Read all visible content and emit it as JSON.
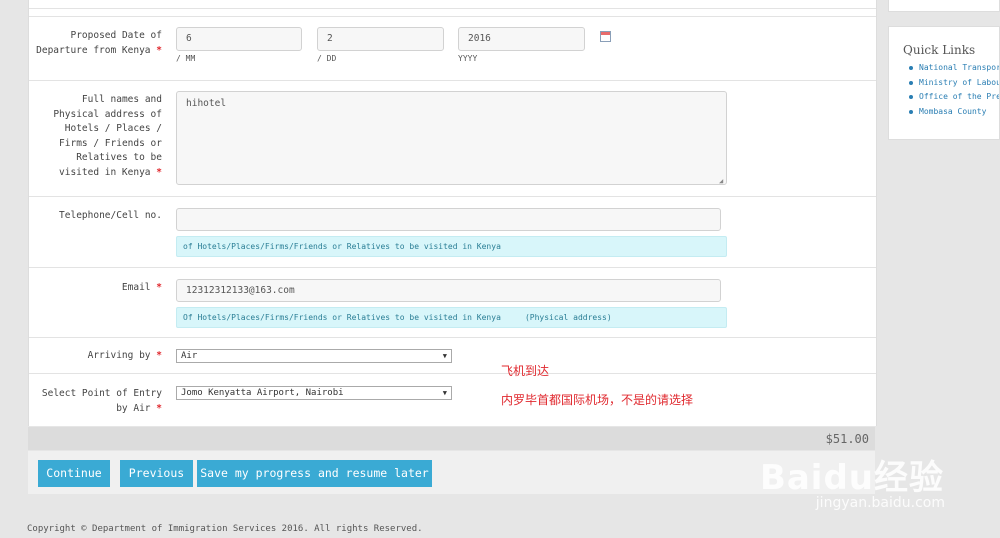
{
  "form": {
    "departure": {
      "label": "Proposed Date of Departure from Kenya",
      "day": "6",
      "day_hint": "/ MM",
      "month": "2",
      "month_hint": "/ DD",
      "year": "2016",
      "year_hint": "YYYY"
    },
    "address": {
      "label": "Full names and Physical address of Hotels / Places / Firms / Friends or Relatives to be visited in Kenya",
      "value": "hihotel"
    },
    "telephone": {
      "label": "Telephone/Cell no.",
      "value": "",
      "note": "of Hotels/Places/Firms/Friends or Relatives to be visited in Kenya"
    },
    "email": {
      "label": "Email",
      "value": "12312312133@163.com",
      "note": "Of Hotels/Places/Firms/Friends or Relatives to be visited in Kenya     (Physical address)"
    },
    "arriving": {
      "label": "Arriving by",
      "value": "Air"
    },
    "entry_point": {
      "label": "Select Point of Entry by Air",
      "value": "Jomo Kenyatta Airport, Nairobi"
    },
    "required_mark": "*"
  },
  "annotations": {
    "arriving": "飞机到达",
    "entry": "内罗毕首都国际机场，不是的请选择"
  },
  "price": "$51.00",
  "buttons": {
    "continue": "Continue",
    "previous": "Previous",
    "save": "Save my progress and resume later"
  },
  "footer": {
    "copyright": "Copyright © Department of Immigration Services 2016. All rights Reserved."
  },
  "sidebar": {
    "title": "Quick Links",
    "links": [
      "National Transport",
      "Ministry of Labour",
      "Office of the President",
      "Mombasa County"
    ]
  },
  "watermark": {
    "brand": "Baidu经验",
    "url": "jingyan.baidu.com"
  },
  "colors": {
    "accent": "#3aaad4",
    "required": "#e0282e",
    "note_bg": "#d8f6fa"
  }
}
